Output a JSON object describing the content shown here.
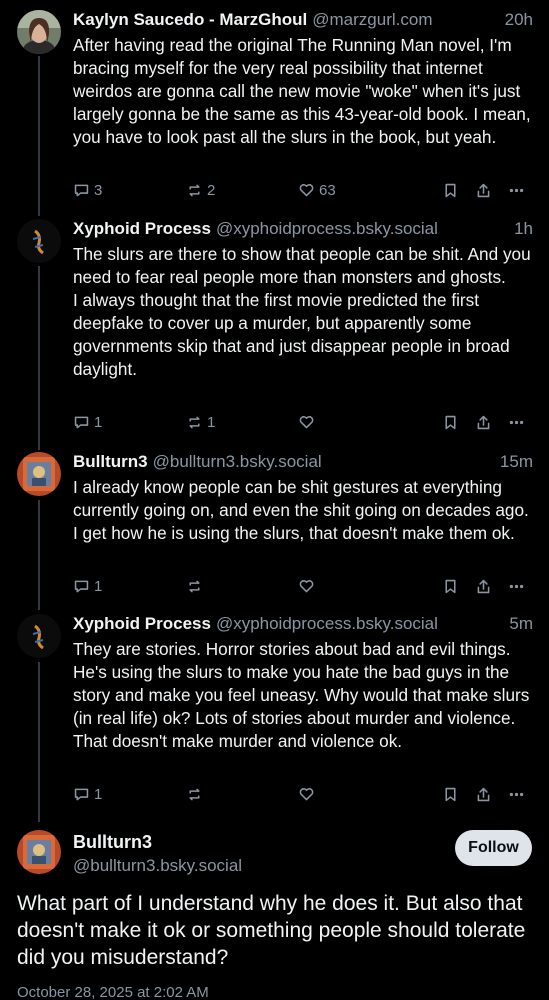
{
  "posts": [
    {
      "name": "Kaylyn Saucedo - MarzGhoul",
      "handle": "@marzgurl.com",
      "time": "20h",
      "text": "After having read the original The Running Man novel, I'm bracing myself for the very real possibility that internet weirdos are gonna call the new movie \"woke\" when it's just largely gonna be the same as this 43-year-old book. I mean, you have to look past all the slurs in the book, but yeah.",
      "replies": "3",
      "reposts": "2",
      "likes": "63"
    },
    {
      "name": "Xyphoid Process",
      "handle": "@xyphoidprocess.bsky.social",
      "time": "1h",
      "text": "The slurs are there to show that people can be shit. And you need to fear real people more than monsters and ghosts.\nI always thought that the first movie predicted the first deepfake to cover up a murder, but apparently some governments skip that and just disappear people in broad daylight.",
      "replies": "1",
      "reposts": "1",
      "likes": ""
    },
    {
      "name": "Bullturn3",
      "handle": "@bullturn3.bsky.social",
      "time": "15m",
      "text": "I already know people can be shit gestures at everything currently going on, and even the shit going on decades ago. I get how he is using the slurs, that doesn't make them ok.",
      "replies": "1",
      "reposts": "",
      "likes": ""
    },
    {
      "name": "Xyphoid Process",
      "handle": "@xyphoidprocess.bsky.social",
      "time": "5m",
      "text": "They are stories. Horror stories about bad and evil things. He's using the slurs to make you hate the bad guys in the story and make you feel uneasy. Why would that make slurs (in real life) ok? Lots of stories about murder and violence. That doesn't make murder and violence ok.",
      "replies": "1",
      "reposts": "",
      "likes": ""
    }
  ],
  "main_post": {
    "name": "Bullturn3",
    "handle": "@bullturn3.bsky.social",
    "follow_label": "Follow",
    "text": "What part of I understand why he does it. But also that doesn't make it ok or something people should tolerate did you misuderstand?",
    "date": "October 28, 2025 at 2:02 AM"
  },
  "icons": {
    "reply": "reply-bubble-icon",
    "repost": "repost-arrows-icon",
    "like": "heart-icon",
    "bookmark": "bookmark-icon",
    "share": "share-icon",
    "more": "more-dots-icon"
  },
  "colors": {
    "background": "#000000",
    "text": "#f1f3f5",
    "muted": "#8a96a3",
    "thread_line": "#2e3a46",
    "follow_button": "#dfe4ea"
  }
}
